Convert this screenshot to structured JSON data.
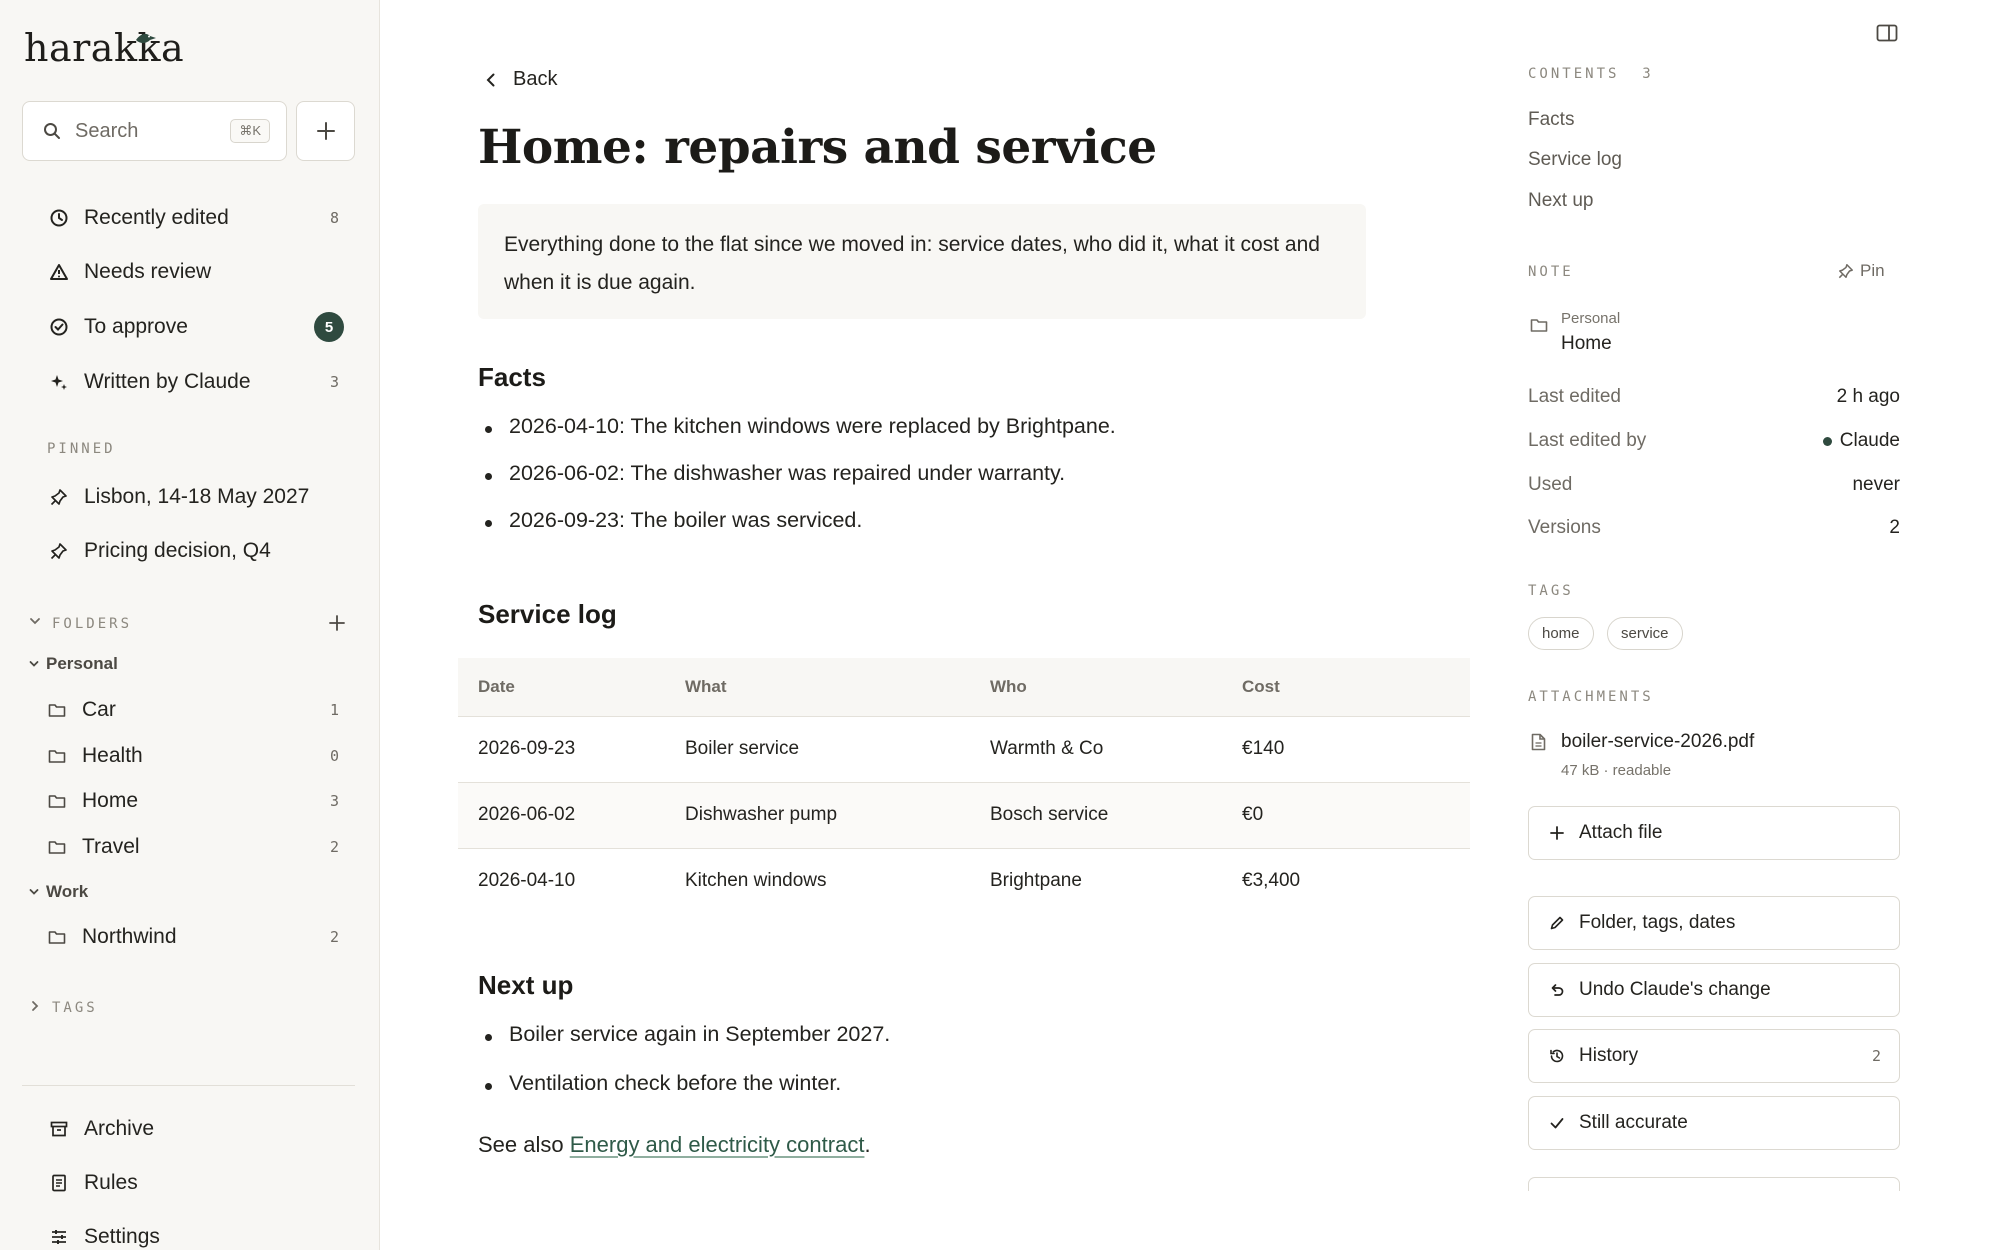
{
  "app": {
    "name": "harakka"
  },
  "sidebar": {
    "search": {
      "label": "Search",
      "shortcut": "⌘K"
    },
    "nav": [
      {
        "label": "Recently edited",
        "count": "8"
      },
      {
        "label": "Needs review",
        "count": ""
      },
      {
        "label": "To approve",
        "count": "5"
      },
      {
        "label": "Written by Claude",
        "count": "3"
      }
    ],
    "pinned_label": "PINNED",
    "pinned": [
      {
        "label": "Lisbon, 14-18 May 2027"
      },
      {
        "label": "Pricing decision, Q4"
      }
    ],
    "folders_label": "FOLDERS",
    "folder_groups": [
      {
        "label": "Personal",
        "items": [
          {
            "label": "Car",
            "count": "1"
          },
          {
            "label": "Health",
            "count": "0"
          },
          {
            "label": "Home",
            "count": "3"
          },
          {
            "label": "Travel",
            "count": "2"
          }
        ]
      },
      {
        "label": "Work",
        "items": [
          {
            "label": "Northwind",
            "count": "2"
          }
        ]
      }
    ],
    "tags_label": "TAGS",
    "footer": [
      {
        "label": "Archive"
      },
      {
        "label": "Rules"
      },
      {
        "label": "Settings"
      }
    ]
  },
  "main": {
    "back_label": "Back",
    "title": "Home: repairs and service",
    "summary": "Everything done to the flat since we moved in: service dates, who did it, what it cost and when it is due again.",
    "facts_heading": "Facts",
    "facts": [
      "2026-04-10: The kitchen windows were replaced by Brightpane.",
      "2026-06-02: The dishwasher was repaired under warranty.",
      "2026-09-23: The boiler was serviced."
    ],
    "log_heading": "Service log",
    "log_columns": [
      "Date",
      "What",
      "Who",
      "Cost"
    ],
    "log_rows": [
      [
        "2026-09-23",
        "Boiler service",
        "Warmth & Co",
        "€140"
      ],
      [
        "2026-06-02",
        "Dishwasher pump",
        "Bosch service",
        "€0"
      ],
      [
        "2026-04-10",
        "Kitchen windows",
        "Brightpane",
        "€3,400"
      ]
    ],
    "next_heading": "Next up",
    "next": [
      "Boiler service again in September 2027.",
      "Ventilation check before the winter."
    ],
    "see_also_prefix": "See also ",
    "see_also_link": "Energy and electricity contract",
    "see_also_suffix": "."
  },
  "panel": {
    "contents_label": "CONTENTS",
    "contents_count": "3",
    "contents": [
      "Facts",
      "Service log",
      "Next up"
    ],
    "note_label": "NOTE",
    "pin_label": "Pin",
    "folder_parent": "Personal",
    "folder_name": "Home",
    "meta": [
      {
        "key": "Last edited",
        "value": "2 h ago"
      },
      {
        "key": "Last edited by",
        "value": "Claude"
      },
      {
        "key": "Used",
        "value": "never"
      },
      {
        "key": "Versions",
        "value": "2"
      }
    ],
    "tags_label": "TAGS",
    "tags": [
      "home",
      "service"
    ],
    "attachments_label": "ATTACHMENTS",
    "attachment_name": "boiler-service-2026.pdf",
    "attachment_meta": "47 kB · readable",
    "attach_button": "Attach file",
    "actions": [
      {
        "label": "Folder, tags, dates",
        "count": ""
      },
      {
        "label": "Undo Claude's change",
        "count": ""
      },
      {
        "label": "History",
        "count": "2"
      },
      {
        "label": "Still accurate",
        "count": ""
      }
    ]
  },
  "colors": {
    "accent": "#2f4a3f",
    "link": "#2f5a48",
    "sidebar_bg": "#f8f7f4"
  }
}
